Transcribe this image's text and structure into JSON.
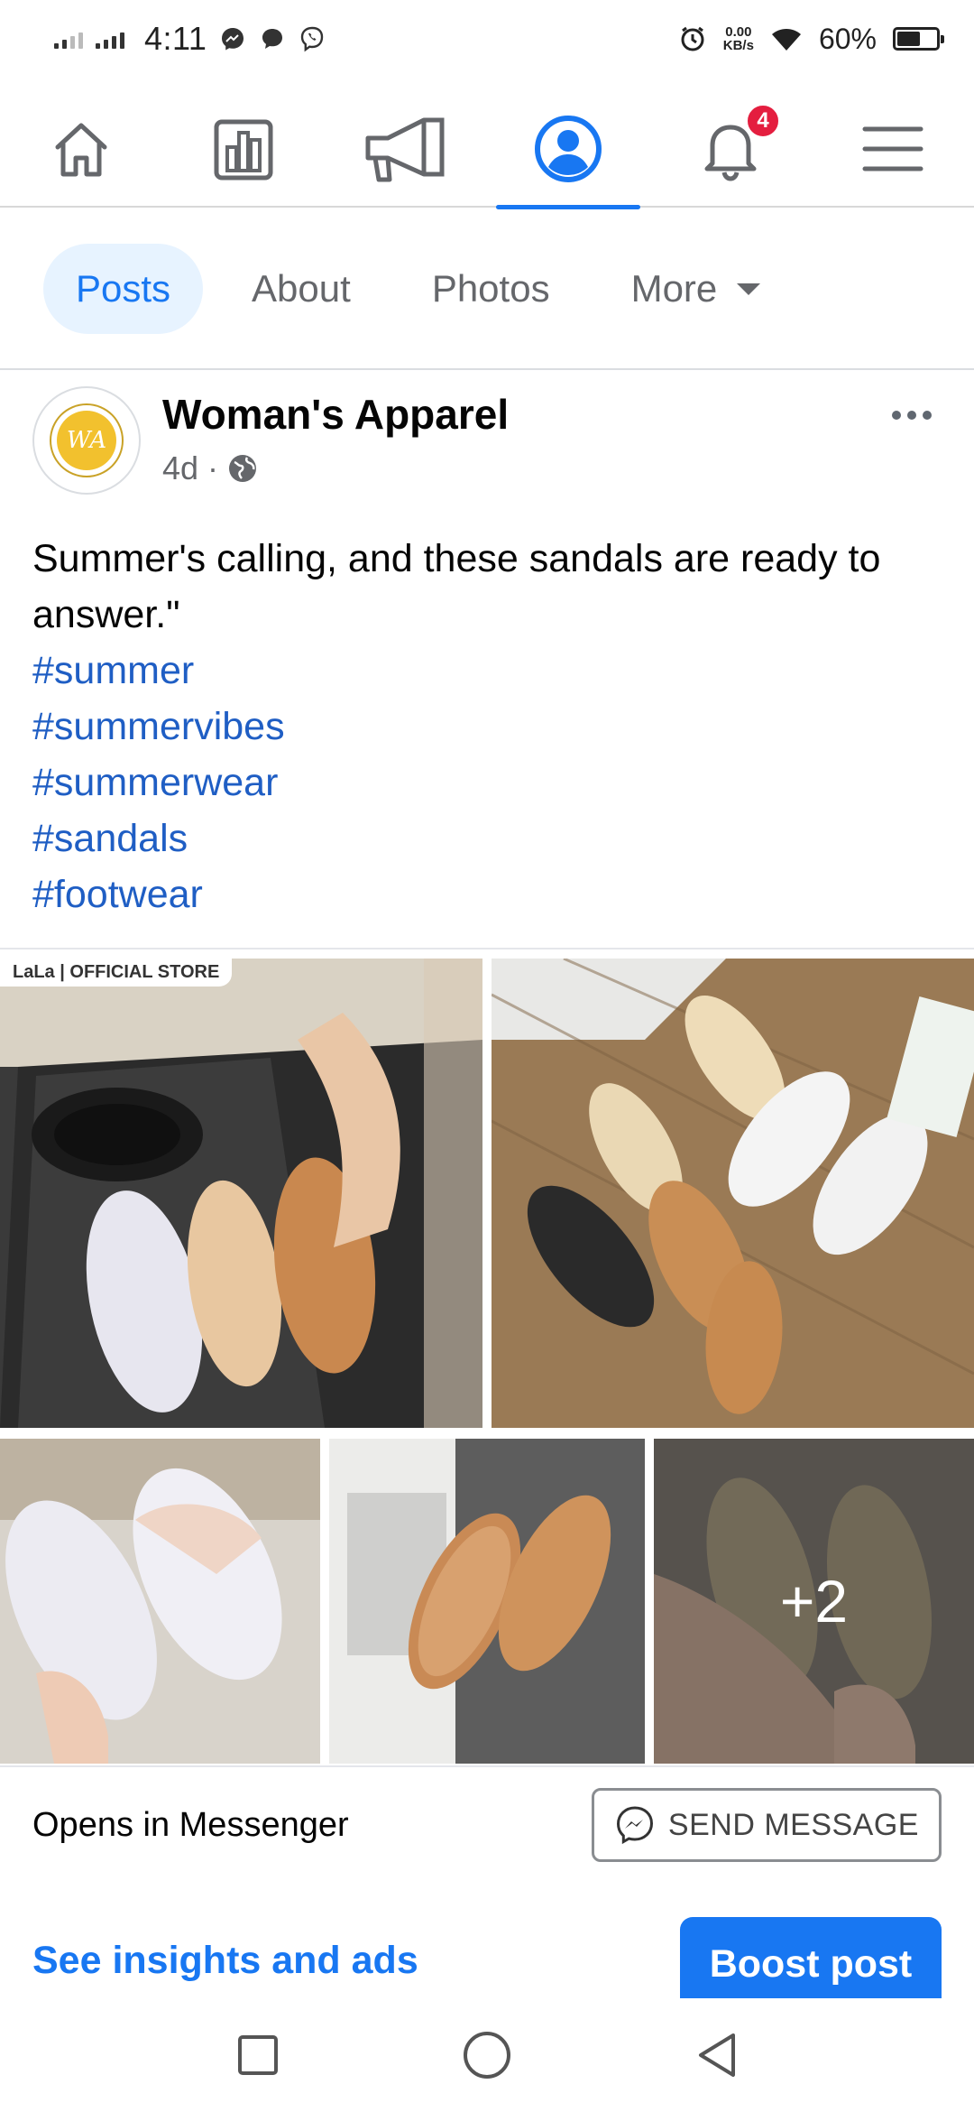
{
  "status_bar": {
    "time": "4:11",
    "net_speed_value": "0.00",
    "net_speed_unit": "KB/s",
    "battery_text": "60%",
    "battery_level": 0.6,
    "icons": [
      "signal-icon",
      "messenger-icon",
      "chat-icon",
      "viber-icon",
      "alarm-icon",
      "wifi-icon",
      "battery-icon"
    ]
  },
  "topnav": {
    "items": [
      {
        "icon": "home-icon"
      },
      {
        "icon": "insights-icon"
      },
      {
        "icon": "megaphone-icon"
      },
      {
        "icon": "profile-icon",
        "active": true
      },
      {
        "icon": "bell-icon",
        "badge": "4"
      },
      {
        "icon": "menu-icon"
      }
    ]
  },
  "tabs": [
    {
      "label": "Posts",
      "active": true
    },
    {
      "label": "About"
    },
    {
      "label": "Photos"
    },
    {
      "label": "More"
    }
  ],
  "post": {
    "page_name": "Woman's Apparel",
    "avatar_text": "WA",
    "time": "4d",
    "separator": "·",
    "body": "Summer's calling, and these sandals are ready to answer.\"",
    "hashtags": [
      "#summer",
      "#summervibes",
      "#summerwear",
      "#sandals",
      "#footwear"
    ],
    "photos": {
      "store_label": "LaLa | OFFICIAL STORE",
      "more_count": "+2"
    }
  },
  "messenger": {
    "text": "Opens in Messenger",
    "button_label": "SEND MESSAGE"
  },
  "actions": {
    "insights_label": "See insights and ads",
    "boost_label": "Boost post"
  },
  "colors": {
    "accent": "#1877f2",
    "hashtag": "#1f5ec4",
    "badge": "#e41e3f",
    "tab_active_bg": "#e7f3ff",
    "muted_text": "#65676b"
  }
}
